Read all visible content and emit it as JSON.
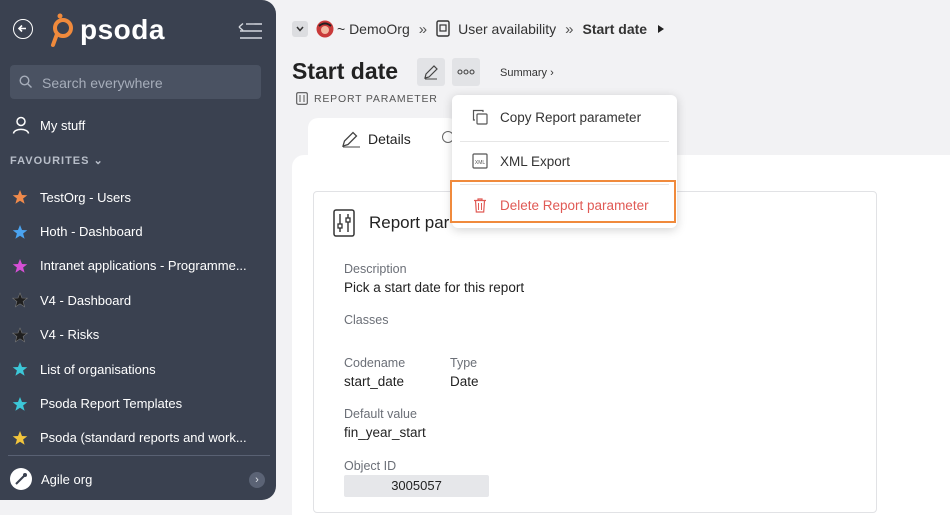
{
  "sidebar": {
    "logo_text": "psoda",
    "search_placeholder": "Search everywhere",
    "my_stuff": "My stuff",
    "favourites_header": "FAVOURITES",
    "favourites": [
      {
        "label": "TestOrg - Users",
        "color": "#f08a4b"
      },
      {
        "label": "Hoth - Dashboard",
        "color": "#4aa3f0"
      },
      {
        "label": "Intranet applications - Programme...",
        "color": "#d64fd6"
      },
      {
        "label": "V4 - Dashboard",
        "color": "#2b2b2b"
      },
      {
        "label": "V4 - Risks",
        "color": "#2b2b2b"
      },
      {
        "label": "List of organisations",
        "color": "#3cc7d8"
      },
      {
        "label": "Psoda Report Templates",
        "color": "#3cc7d8"
      },
      {
        "label": "Psoda (standard reports and work...",
        "color": "#f2c53c"
      }
    ],
    "org_name": "Agile org"
  },
  "breadcrumb": {
    "org": "~ DemoOrg",
    "sep1": "»",
    "page": "User availability",
    "sep2": "»",
    "current": "Start date"
  },
  "page": {
    "title": "Start date",
    "summary_link": "Summary ›",
    "subtype": "REPORT PARAMETER",
    "tab_details": "Details"
  },
  "menu": {
    "copy": "Copy Report parameter",
    "xml": "XML Export",
    "delete": "Delete Report parameter"
  },
  "card": {
    "title": "Report par",
    "description_label": "Description",
    "description_value": "Pick a start date for this report",
    "classes_label": "Classes",
    "codename_label": "Codename",
    "codename_value": "start_date",
    "type_label": "Type",
    "type_value": "Date",
    "default_label": "Default value",
    "default_value": "fin_year_start",
    "objectid_label": "Object ID",
    "objectid_value": "3005057"
  },
  "colors": {
    "sidebar_bg": "#3a4150",
    "danger": "#e05a55",
    "highlight": "#f08a3c"
  }
}
